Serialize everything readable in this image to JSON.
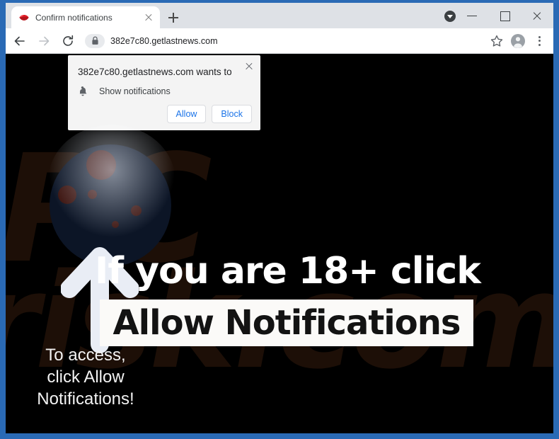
{
  "window": {
    "controls": {
      "badge_icon": "downloads-badge-icon",
      "minimize_label": "–",
      "maximize_label": "□",
      "close_label": "×"
    }
  },
  "tab": {
    "title": "Confirm notifications",
    "favicon_icon": "lips-favicon-icon",
    "close_icon": "close-icon",
    "newtab_icon": "plus-icon"
  },
  "toolbar": {
    "back_icon": "back-arrow-icon",
    "forward_icon": "forward-arrow-icon",
    "reload_icon": "reload-icon",
    "lock_icon": "lock-icon",
    "url": "382e7c80.getlastnews.com",
    "bookmark_icon": "star-icon",
    "profile_icon": "profile-avatar-icon",
    "menu_icon": "three-dot-menu-icon"
  },
  "permission_dialog": {
    "title": "382e7c80.getlastnews.com wants to",
    "option_icon": "bell-icon",
    "option_label": "Show notifications",
    "allow_label": "Allow",
    "block_label": "Block",
    "close_icon": "close-icon",
    "accent_color": "#1a73e8"
  },
  "page": {
    "headline": "If you are 18+ click",
    "allow_box_text": "Allow Notifications",
    "subtext_lines": [
      "To access,",
      "click Allow",
      "Notifications!"
    ],
    "arrow_icon": "up-arrow-icon",
    "watermark_line1": "PC",
    "watermark_line2": "risk.com",
    "background_color": "#000000",
    "frame_color": "#2a6ab5"
  }
}
